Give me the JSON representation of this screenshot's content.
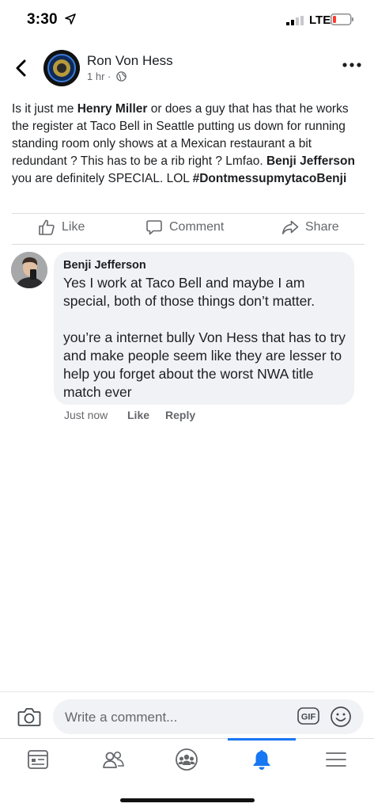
{
  "status_bar": {
    "time": "3:30",
    "network": "LTE"
  },
  "post": {
    "author": "Ron Von Hess",
    "time_ago": "1 hr",
    "text_segments": [
      {
        "t": "Is it just me ",
        "bold": false
      },
      {
        "t": "Henry Miller",
        "bold": true
      },
      {
        "t": " or does a guy that has that he works the register at Taco Bell in Seattle putting us down for running standing room only shows at a Mexican restaurant a bit redundant ? This has to be a rib right ? Lmfao.  ",
        "bold": false
      },
      {
        "t": "Benji Jefferson",
        "bold": true
      },
      {
        "t": " you are definitely SPECIAL. LOL ",
        "bold": false
      },
      {
        "t": "#DontmessupmytacoBenji",
        "bold": true
      }
    ],
    "actions": {
      "like": "Like",
      "comment": "Comment",
      "share": "Share"
    }
  },
  "comment": {
    "author": "Benji Jefferson",
    "text": "Yes I work at Taco Bell and maybe I am special, both of those things don’t matter.\n\nyou’re a internet bully Von Hess that has to try and make people seem like they are lesser to help you forget about the worst NWA title match ever",
    "time": "Just now",
    "like": "Like",
    "reply": "Reply"
  },
  "composer": {
    "placeholder": "Write a comment...",
    "gif_label": "GIF"
  },
  "tabs": [
    {
      "icon": "news-feed-icon",
      "active": false
    },
    {
      "icon": "friends-icon",
      "active": false
    },
    {
      "icon": "groups-icon",
      "active": false
    },
    {
      "icon": "notifications-icon",
      "active": true
    },
    {
      "icon": "menu-icon",
      "active": false
    }
  ],
  "colors": {
    "accent": "#1877f2",
    "secondary_text": "#65676b",
    "bubble": "#f0f2f5"
  }
}
